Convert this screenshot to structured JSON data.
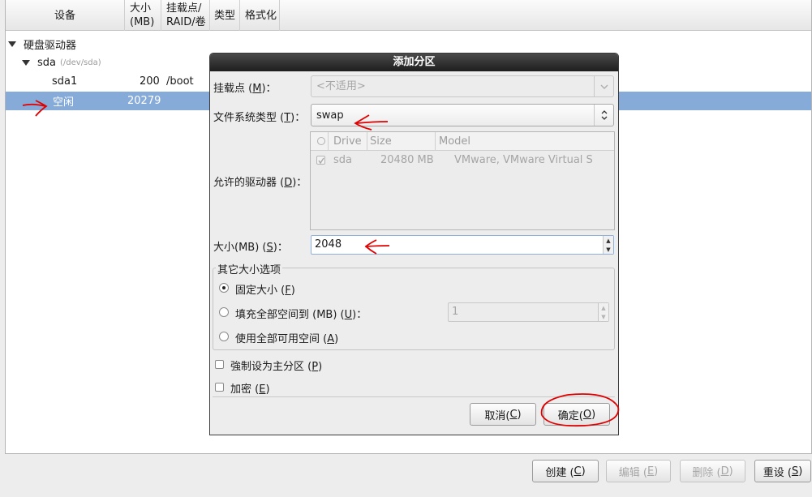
{
  "tree": {
    "headers": {
      "device": "设备",
      "size": "大小\n(MB)",
      "mount": "挂载点/\nRAID/卷",
      "type": "类型",
      "format": "格式化"
    },
    "rows": [
      {
        "label": "硬盘驱动器"
      },
      {
        "label": "sda",
        "sub": "(/dev/sda)"
      },
      {
        "label": "sda1",
        "size": "200",
        "mount": "/boot"
      },
      {
        "label": "空闲",
        "size": "20279"
      }
    ]
  },
  "dialog": {
    "title": "添加分区",
    "mount_label_pre": "挂载点 (",
    "mount_label_key": "M",
    "mount_label_post": ")：",
    "mount_value": "<不适用>",
    "fstype_label_pre": "文件系统类型 (",
    "fstype_label_key": "T",
    "fstype_label_post": ")：",
    "fstype_value": "swap",
    "drives_label_pre": "允许的驱动器 (",
    "drives_label_key": "D",
    "drives_label_post": ")：",
    "drive_cols": {
      "drive": "Drive",
      "size": "Size",
      "model": "Model"
    },
    "drives": [
      {
        "drive": "sda",
        "size": "20480 MB",
        "model": "VMware, VMware Virtual S"
      }
    ],
    "size_label_pre": "大小(MB) (",
    "size_label_key": "S",
    "size_label_post": ")：",
    "size_value": "2048",
    "other_options_title": "其它大小选项",
    "opt_fixed_pre": "固定大小 (",
    "opt_fixed_key": "F",
    "opt_fixed_post": ")",
    "opt_fill_pre": "填充全部空间到 (MB) (",
    "opt_fill_key": "U",
    "opt_fill_post": ")：",
    "opt_fill_value": "1",
    "opt_max_pre": "使用全部可用空间 (",
    "opt_max_key": "A",
    "opt_max_post": ")",
    "primary_pre": "強制设为主分区 (",
    "primary_key": "P",
    "primary_post": ")",
    "encrypt_pre": "加密 (",
    "encrypt_key": "E",
    "encrypt_post": ")",
    "cancel_pre": "取消(",
    "cancel_key": "C",
    "cancel_post": ")",
    "ok_pre": "确定(",
    "ok_key": "O",
    "ok_post": ")"
  },
  "bottom": {
    "create_pre": "创建 (",
    "create_key": "C",
    "create_post": ")",
    "edit_pre": "编辑 (",
    "edit_key": "E",
    "edit_post": ")",
    "delete_pre": "删除 (",
    "delete_key": "D",
    "delete_post": ")",
    "reset_pre": "重设 (",
    "reset_key": "S",
    "reset_post": ")"
  },
  "annotation_color": "#e00000"
}
